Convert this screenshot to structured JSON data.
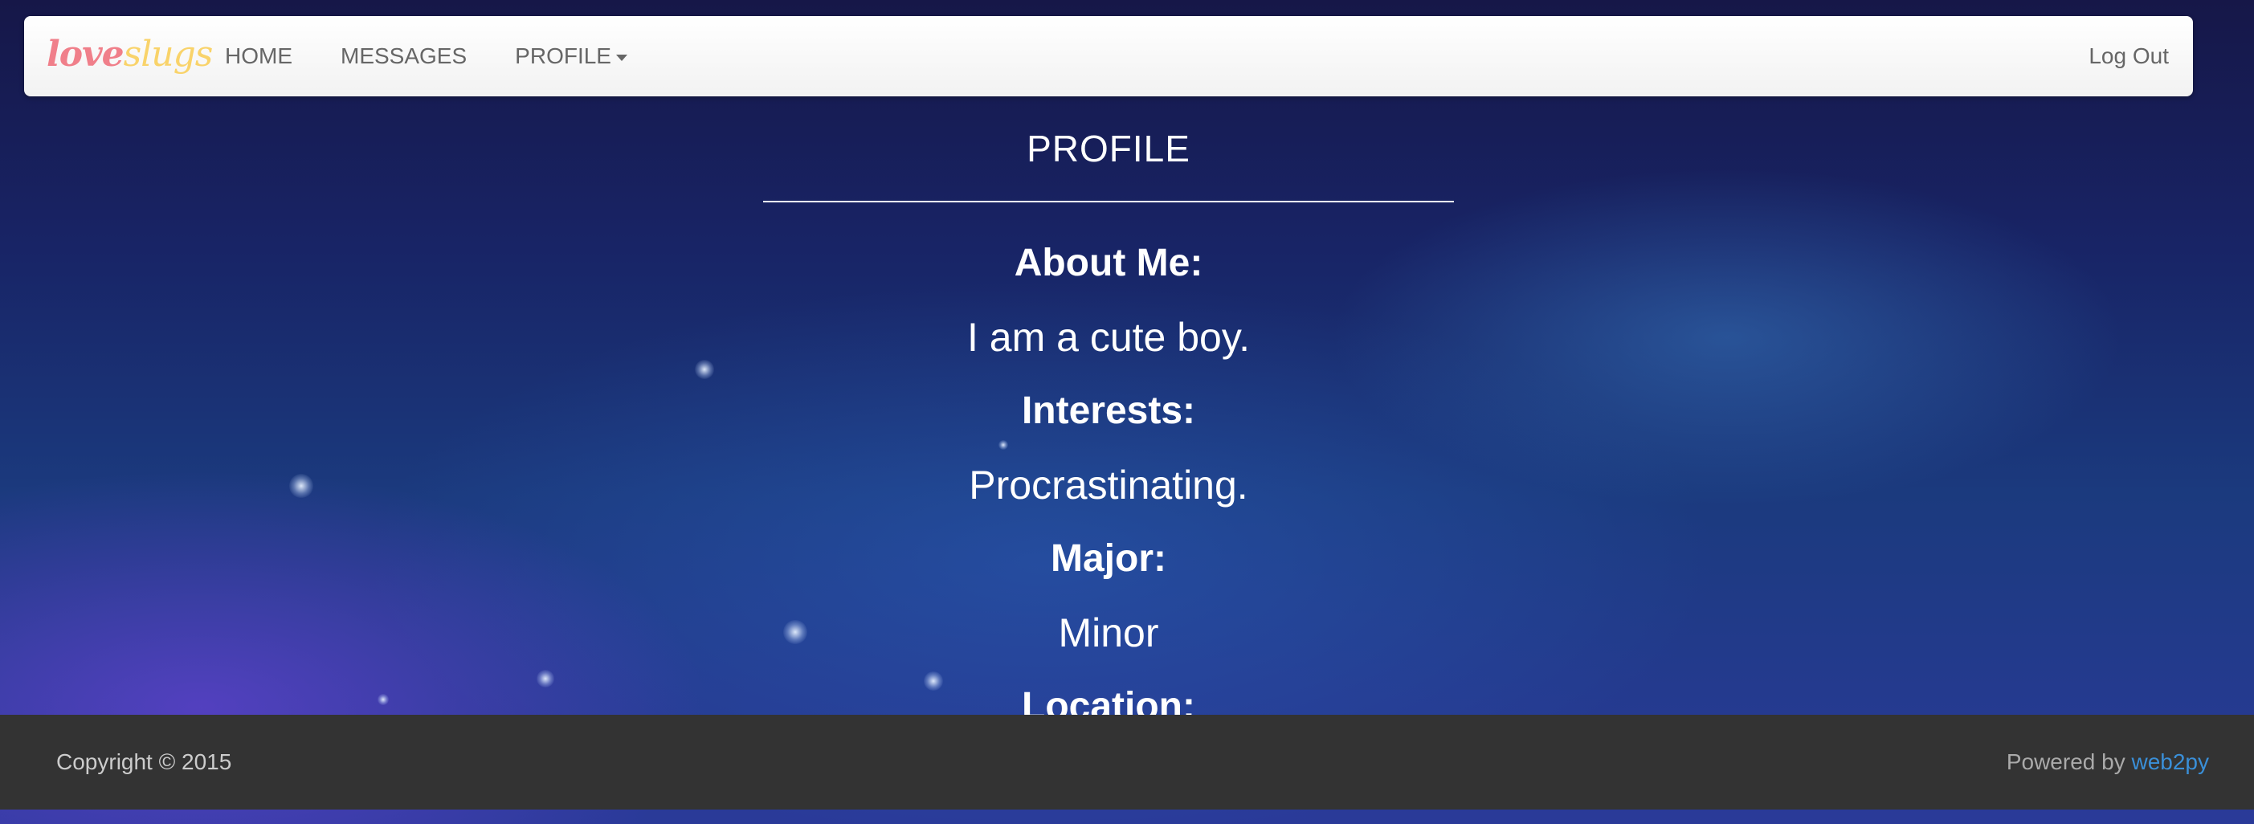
{
  "navbar": {
    "logo": {
      "part1": "love",
      "part2": "slugs"
    },
    "links": [
      {
        "label": "HOME"
      },
      {
        "label": "MESSAGES"
      },
      {
        "label": "PROFILE"
      }
    ],
    "logout_label": "Log Out"
  },
  "main": {
    "title": "PROFILE",
    "fields": [
      {
        "label": "About Me:",
        "value": "I am a cute boy."
      },
      {
        "label": "Interests:",
        "value": "Procrastinating."
      },
      {
        "label": "Major:",
        "value": "Minor"
      },
      {
        "label": "Location:"
      }
    ]
  },
  "footer": {
    "copyright": "Copyright © 2015",
    "powered_prefix": "Powered by",
    "powered_link": "web2py"
  },
  "colors": {
    "logo_love": "#f07f8a",
    "logo_slugs": "#f9d36a",
    "link_accent": "#3a8fd8",
    "footer_bg": "#333333"
  }
}
